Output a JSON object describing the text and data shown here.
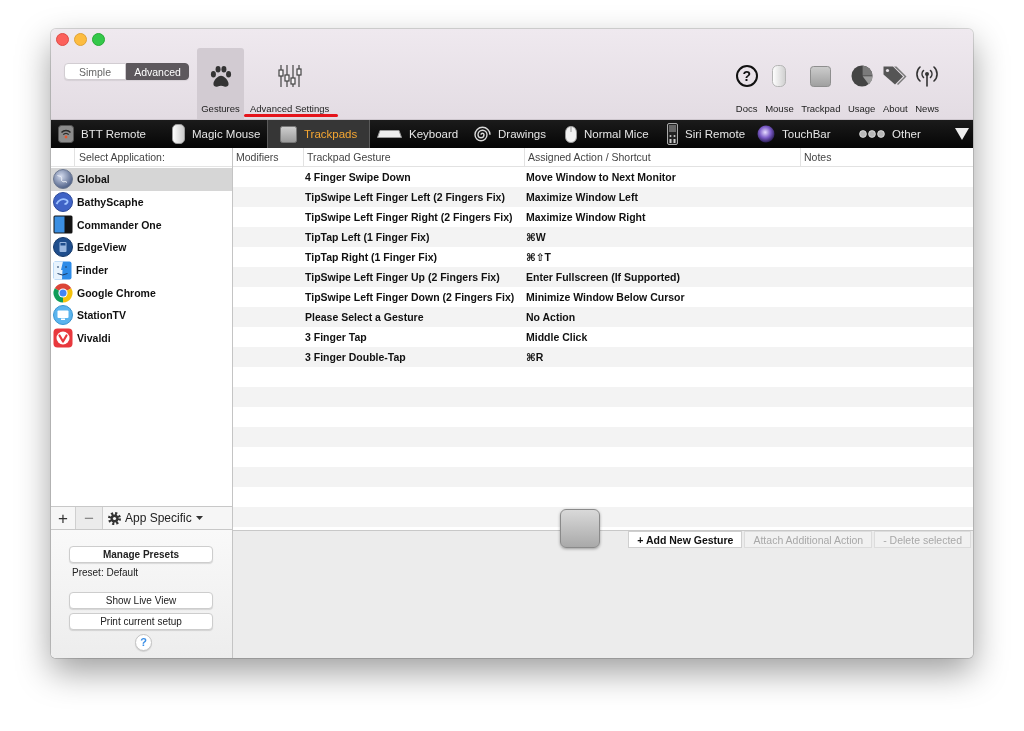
{
  "toolbar": {
    "mode": [
      {
        "label": "Simple",
        "selected": false
      },
      {
        "label": "Advanced",
        "selected": true
      }
    ],
    "sections": [
      {
        "label": "Gestures",
        "selected": true,
        "underlined": false
      },
      {
        "label": "Advanced Settings",
        "selected": false,
        "underlined": true
      }
    ],
    "links": [
      {
        "label": "Docs",
        "glyph": "?"
      },
      {
        "label": "Mouse"
      },
      {
        "label": "Trackpad"
      },
      {
        "label": "Usage"
      },
      {
        "label": "About"
      },
      {
        "label": "News"
      }
    ]
  },
  "device_tabs": [
    {
      "label": "BTT Remote",
      "selected": false
    },
    {
      "label": "Magic Mouse",
      "selected": false
    },
    {
      "label": "Trackpads",
      "selected": true
    },
    {
      "label": "Keyboard",
      "selected": false
    },
    {
      "label": "Drawings",
      "selected": false
    },
    {
      "label": "Normal Mice",
      "selected": false
    },
    {
      "label": "Siri Remote",
      "selected": false
    },
    {
      "label": "TouchBar",
      "selected": false
    },
    {
      "label": "Other",
      "selected": false
    }
  ],
  "sidebar": {
    "header": "Select Application:",
    "apps": [
      {
        "name": "Global",
        "selected": true
      },
      {
        "name": "BathyScaphe",
        "selected": false
      },
      {
        "name": "Commander One",
        "selected": false
      },
      {
        "name": "EdgeView",
        "selected": false
      },
      {
        "name": "Finder",
        "selected": false
      },
      {
        "name": "Google Chrome",
        "selected": false
      },
      {
        "name": "StationTV",
        "selected": false
      },
      {
        "name": "Vivaldi",
        "selected": false
      }
    ],
    "list_buttons": [
      {
        "label": "+",
        "disabled": false
      },
      {
        "label": "−",
        "disabled": true
      }
    ],
    "scope": "App Specific",
    "manage_button": "Manage Presets",
    "preset": "Preset: Default",
    "buttons": [
      "Show Live View",
      "Print current setup"
    ],
    "help": "?"
  },
  "table": {
    "columns": [
      "Modifiers",
      "Trackpad Gesture",
      "Assigned Action / Shortcut",
      "Notes"
    ],
    "rows": [
      {
        "gesture": "4 Finger Swipe Down",
        "action": "Move Window to Next Monitor"
      },
      {
        "gesture": "TipSwipe Left Finger Left (2 Fingers Fix)",
        "action": "Maximize Window Left"
      },
      {
        "gesture": "TipSwipe Left Finger Right (2 Fingers Fix)",
        "action": "Maximize Window Right"
      },
      {
        "gesture": "TipTap Left (1 Finger Fix)",
        "action": "⌘W"
      },
      {
        "gesture": "TipTap Right (1 Finger Fix)",
        "action": "⌘⇧T"
      },
      {
        "gesture": "TipSwipe Left Finger Up (2 Fingers Fix)",
        "action": "Enter Fullscreen (If Supported)"
      },
      {
        "gesture": "TipSwipe Left Finger Down (2 Fingers Fix)",
        "action": "Minimize Window Below Cursor"
      },
      {
        "gesture": "Please Select a Gesture",
        "action": "No Action"
      },
      {
        "gesture": "3 Finger Tap",
        "action": "Middle Click"
      },
      {
        "gesture": "3 Finger Double-Tap",
        "action": "⌘R"
      }
    ]
  },
  "actions": [
    {
      "label": "+ Add New Gesture",
      "disabled": false
    },
    {
      "label": "Attach Additional Action",
      "disabled": true
    },
    {
      "label": "- Delete selected",
      "disabled": true
    }
  ]
}
